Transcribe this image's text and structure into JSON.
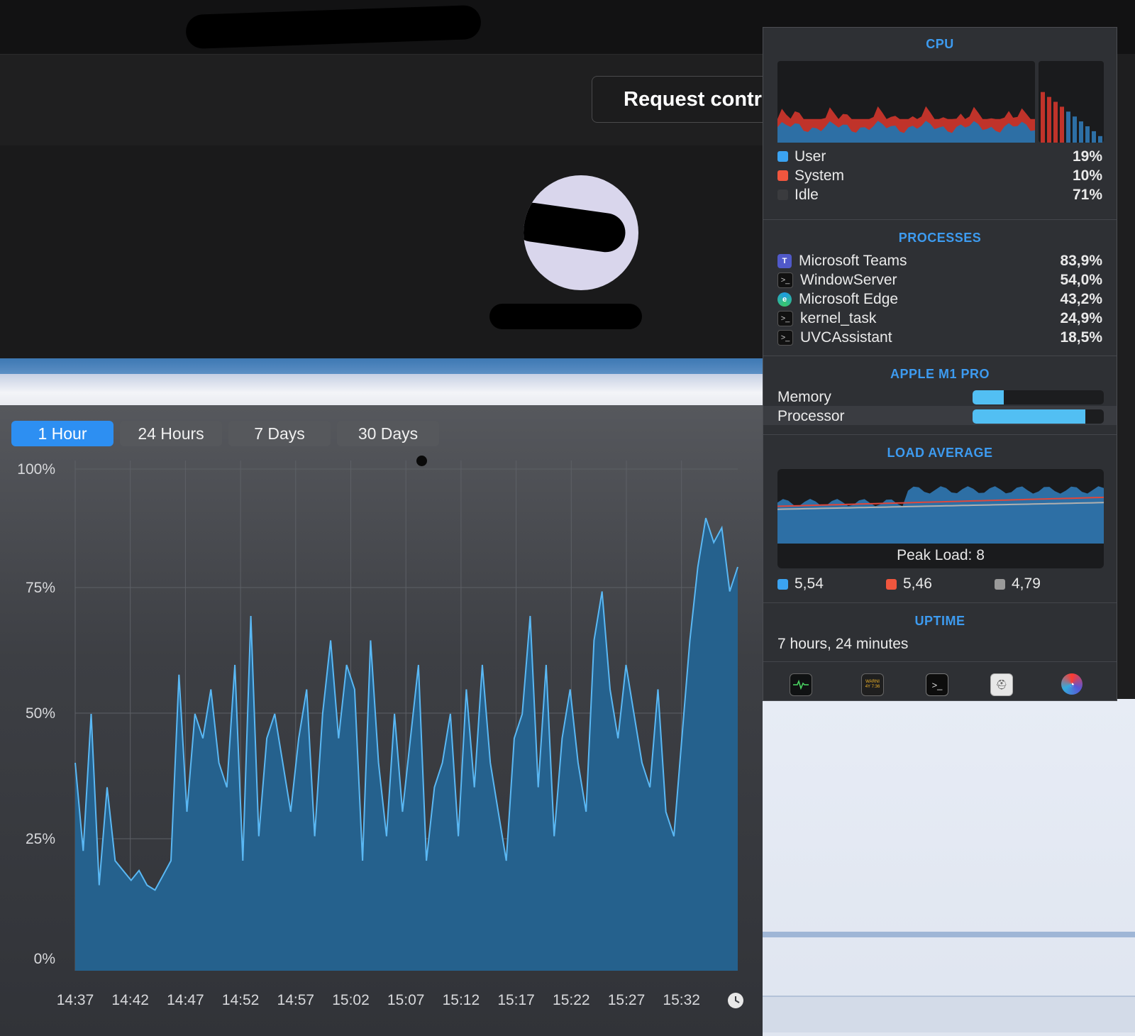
{
  "header": {
    "request_label": "Request contr"
  },
  "range_tabs": [
    "1 Hour",
    "24 Hours",
    "7 Days",
    "30 Days"
  ],
  "chart_data": {
    "type": "area",
    "title": "",
    "xlabel": "",
    "ylabel": "",
    "x_ticks": [
      "14:37",
      "14:42",
      "14:47",
      "14:52",
      "14:57",
      "15:02",
      "15:07",
      "15:12",
      "15:17",
      "15:22",
      "15:27",
      "15:32"
    ],
    "y_ticks": [
      "100%",
      "75%",
      "50%",
      "25%",
      "0%"
    ],
    "ylim": [
      0,
      100
    ],
    "series": [
      {
        "values": [
          40,
          22,
          50,
          15,
          35,
          20,
          18,
          16,
          18,
          15,
          14,
          17,
          20,
          58,
          30,
          50,
          45,
          55,
          40,
          35,
          60,
          20,
          70,
          25,
          45,
          50,
          40,
          30,
          45,
          55,
          25,
          50,
          65,
          45,
          60,
          55,
          20,
          65,
          40,
          25,
          50,
          30,
          45,
          60,
          20,
          35,
          40,
          50,
          25,
          55,
          35,
          60,
          40,
          30,
          20,
          45,
          50,
          70,
          35,
          60,
          25,
          45,
          55,
          40,
          30,
          65,
          75,
          55,
          45,
          60,
          50,
          40,
          35,
          55,
          30,
          25,
          45,
          65,
          80,
          90,
          85,
          88,
          75,
          80
        ]
      }
    ],
    "clock_icon": "clock-icon"
  },
  "popup": {
    "cpu": {
      "title": "CPU",
      "legend": [
        {
          "label": "User",
          "value": "19%",
          "color": "#3ba3f1"
        },
        {
          "label": "System",
          "value": "10%",
          "color": "#f0563e"
        },
        {
          "label": "Idle",
          "value": "71%",
          "color": "#3a3b3e"
        }
      ]
    },
    "processes": {
      "title": "PROCESSES",
      "items": [
        {
          "name": "Microsoft Teams",
          "value": "83,9%",
          "icon": "teams-icon"
        },
        {
          "name": "WindowServer",
          "value": "54,0%",
          "icon": "terminal-icon"
        },
        {
          "name": "Microsoft Edge",
          "value": "43,2%",
          "icon": "edge-icon"
        },
        {
          "name": "kernel_task",
          "value": "24,9%",
          "icon": "terminal-icon"
        },
        {
          "name": "UVCAssistant",
          "value": "18,5%",
          "icon": "terminal-icon"
        }
      ]
    },
    "chip": {
      "title": "APPLE M1 PRO",
      "memory_label": "Memory",
      "memory_fraction": 0.24,
      "processor_label": "Processor",
      "processor_fraction": 0.86
    },
    "load": {
      "title": "LOAD AVERAGE",
      "peak_label": "Peak Load: 8",
      "values": [
        {
          "value": "5,54",
          "color": "#3ba3f1"
        },
        {
          "value": "5,46",
          "color": "#f0563e"
        },
        {
          "value": "4,79",
          "color": "#9a9a9a"
        }
      ]
    },
    "uptime": {
      "title": "UPTIME",
      "value": "7 hours, 24 minutes"
    },
    "toolbar_icons": [
      "activity-monitor-icon",
      "console-icon",
      "terminal-app-icon",
      "disk-utility-icon",
      "istat-icon"
    ],
    "toolbar_badge_text": "WARNI\n4Y 7:36"
  },
  "colors": {
    "accent": "#3d9bf0",
    "chart_fill": "#25618d",
    "chart_line": "#5ab8f4",
    "active_tab": "#2d8ff2"
  }
}
